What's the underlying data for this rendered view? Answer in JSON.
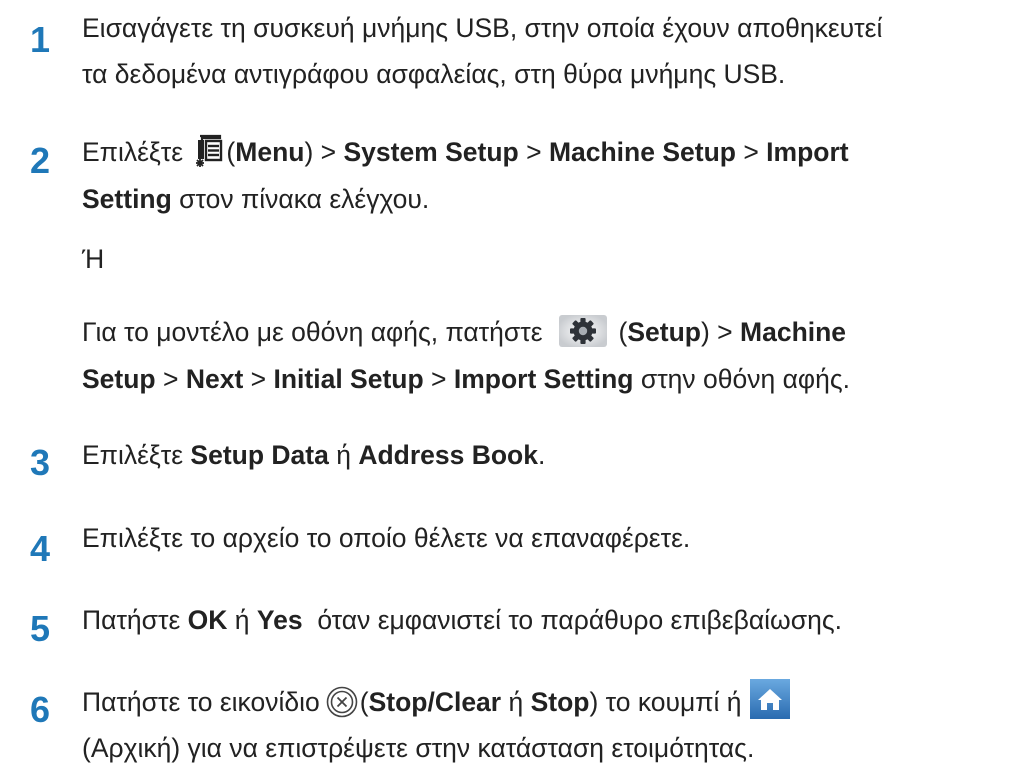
{
  "steps": [
    {
      "number": "1",
      "line1": "Εισαγάγετε τη συσκευή μνήμης USB, στην οποία έχουν αποθηκευτεί",
      "line2": "τα δεδομένα αντιγράφου ασφαλείας, στη θύρα μνήμης USB."
    },
    {
      "number": "2",
      "p1": {
        "prefix": "Επιλέξτε ",
        "icon": "menu-icon",
        "open": "(",
        "menu": "Menu",
        "close": ")",
        "sep1": " > ",
        "system_setup": "System Setup",
        "sep2": " > ",
        "machine_setup": "Machine Setup",
        "sep3": " > ",
        "import": "Import",
        "setting": "Setting",
        "suffix": " στον πίνακα ελέγχου."
      },
      "or_text": "Ή",
      "p2": {
        "prefix": "Για το μοντέλο με οθόνη αφής, πατήστε",
        "icon": "gear-icon",
        "open": "(",
        "setup": "Setup",
        "close": ")",
        "sep1": " > ",
        "machine": "Machine",
        "setup2": "Setup",
        "sep2": " > ",
        "next": "Next",
        "sep3": " > ",
        "initial_setup": "Initial Setup",
        "sep4": " > ",
        "import_setting": "Import Setting",
        "suffix": " στην οθόνη αφής."
      }
    },
    {
      "number": "3",
      "prefix": "Επιλέξτε ",
      "setup_data": "Setup Data",
      "or": " ή ",
      "address_book": "Address Book",
      "suffix": "."
    },
    {
      "number": "4",
      "text": "Επιλέξτε το αρχείο το οποίο θέλετε να επαναφέρετε."
    },
    {
      "number": "5",
      "prefix": "Πατήστε ",
      "ok": "OK",
      "or": " ή ",
      "yes": "Yes",
      "suffix": "  όταν εμφανιστεί το παράθυρο επιβεβαίωσης."
    },
    {
      "number": "6",
      "prefix": "Πατήστε το εικονίδιο",
      "icon": "stop-clear-icon",
      "open": "(",
      "stop_clear": "Stop/Clear",
      "or": " ή ",
      "stop": "Stop",
      "close": ")",
      "mid": " το κουμπί ή",
      "home_icon": "home-icon",
      "line2": "(Αρχική) για να επιστρέψετε στην κατάσταση ετοιμότητας."
    }
  ],
  "colors": {
    "step_number": "#1f78b8",
    "text": "#222222",
    "home_button": "#3a7fc4"
  }
}
